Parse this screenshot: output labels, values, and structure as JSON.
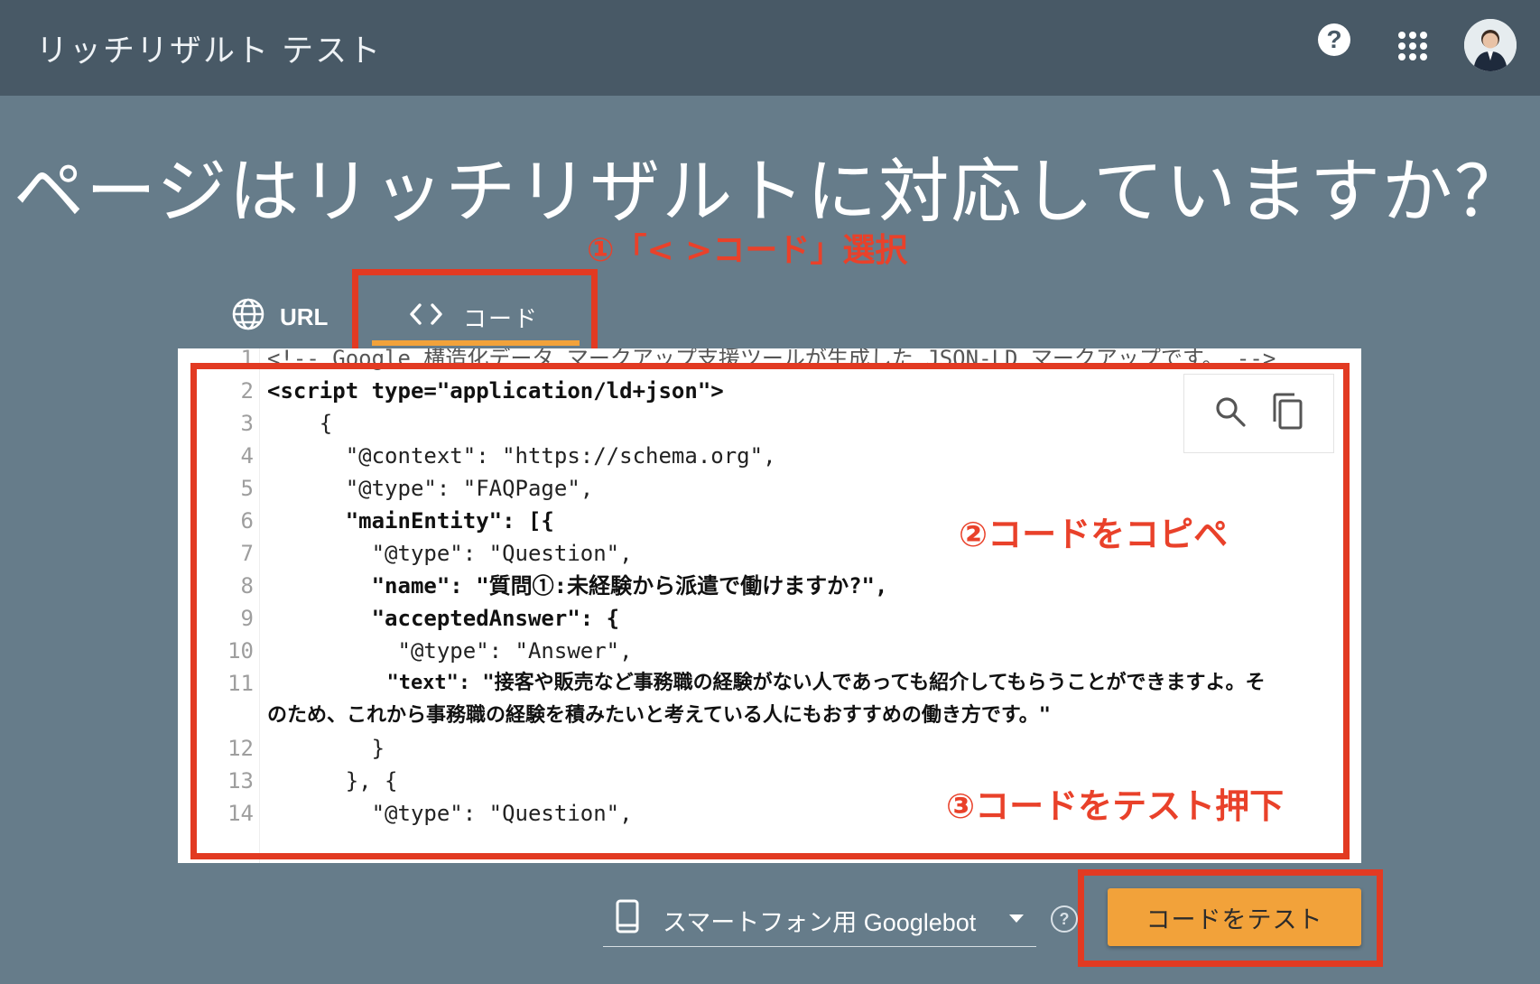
{
  "app": {
    "title": "リッチリザルト テスト"
  },
  "header": {
    "help_icon": "help-icon",
    "apps_icon": "apps-grid-icon"
  },
  "headline": "ページはリッチリザルトに対応していますか？",
  "tabs": [
    {
      "label": "URL",
      "icon": "globe-icon"
    },
    {
      "label": "コード",
      "icon": "code-brackets-icon",
      "selected": true
    }
  ],
  "annotations": {
    "step1": "①「< >コード」選択",
    "step2": "②コードをコピペ",
    "step3": "③コードをテスト押下",
    "color": "#e23a22"
  },
  "code_lines": [
    {
      "n": "1",
      "text": "<!-- Google 構造化データ マークアップ支援ツールが生成した JSON-LD マークアップです。 -->"
    },
    {
      "n": "2",
      "text": "<script type=\"application/ld+json\">"
    },
    {
      "n": "3",
      "text": "    {"
    },
    {
      "n": "4",
      "text": "      \"@context\": \"https://schema.org\","
    },
    {
      "n": "5",
      "text": "      \"@type\": \"FAQPage\","
    },
    {
      "n": "6",
      "text": "      \"mainEntity\": [{"
    },
    {
      "n": "7",
      "text": "        \"@type\": \"Question\","
    },
    {
      "n": "8",
      "text": "        \"name\": \"質問①:未経験から派遣で働けますか?\","
    },
    {
      "n": "9",
      "text": "        \"acceptedAnswer\": {"
    },
    {
      "n": "10",
      "text": "          \"@type\": \"Answer\","
    },
    {
      "n": "11",
      "text": "          \"text\": \"接客や販売など事務職の経験がない人であっても紹介してもらうことができますよ。そ"
    },
    {
      "n": "",
      "text": "のため、これから事務職の経験を積みたいと考えている人にもおすすめの働き方です。\""
    },
    {
      "n": "12",
      "text": "        }"
    },
    {
      "n": "13",
      "text": "      }, {"
    },
    {
      "n": "14",
      "text": "        \"@type\": \"Question\","
    }
  ],
  "editor_tools": {
    "search_icon": "search-icon",
    "copy_icon": "copy-icon"
  },
  "device_select": {
    "value": "スマートフォン用 Googlebot",
    "icon": "smartphone-icon"
  },
  "test_button": {
    "label": "コードをテスト",
    "color": "#f2a23a"
  }
}
